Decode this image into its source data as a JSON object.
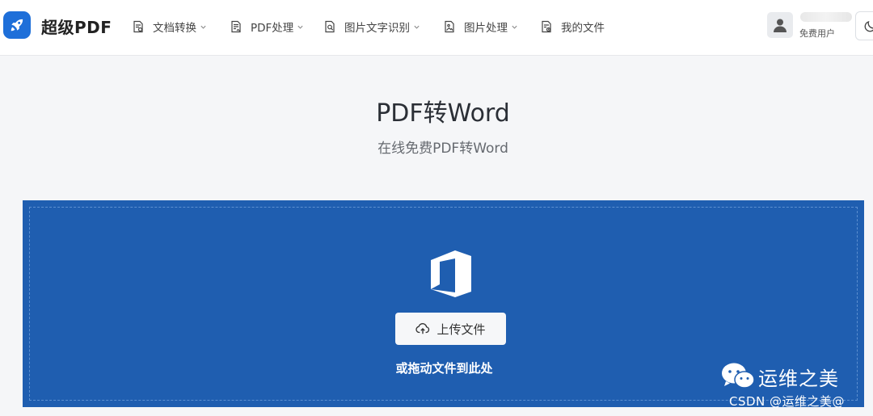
{
  "header": {
    "brand": "超级PDF",
    "nav": [
      {
        "label": "文档转换",
        "icon": "document-convert-icon",
        "dropdown": true
      },
      {
        "label": "PDF处理",
        "icon": "pdf-edit-icon",
        "dropdown": true
      },
      {
        "label": "图片文字识别",
        "icon": "image-ocr-icon",
        "dropdown": true
      },
      {
        "label": "图片处理",
        "icon": "image-file-icon",
        "dropdown": true
      },
      {
        "label": "我的文件",
        "icon": "my-files-icon",
        "dropdown": false
      }
    ],
    "user": {
      "role": "免费用户"
    }
  },
  "main": {
    "title": "PDF转Word",
    "subtitle": "在线免费PDF转Word",
    "upload_button": "上传文件",
    "drag_hint": "或拖动文件到此处"
  },
  "watermark": {
    "channel": "运维之美",
    "csdn": "CSDN @运维之美@"
  },
  "colors": {
    "accent": "#1e6fd9",
    "upload_bg": "#1f5eb0",
    "page_bg": "#f5f6f8"
  }
}
